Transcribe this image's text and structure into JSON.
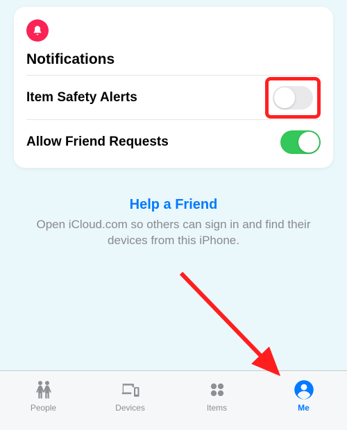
{
  "colors": {
    "accent": "#007aff",
    "notification_badge": "#fb2255",
    "toggle_on": "#34c759",
    "toggle_off": "#e9e9eb",
    "highlight": "#ff2020"
  },
  "card": {
    "title": "Notifications",
    "rows": [
      {
        "id": "item-safety-alerts",
        "label": "Item Safety Alerts",
        "on": false,
        "highlighted": true
      },
      {
        "id": "allow-friend-requests",
        "label": "Allow Friend Requests",
        "on": true,
        "highlighted": false
      }
    ]
  },
  "help": {
    "link": "Help a Friend",
    "text": "Open iCloud.com so others can sign in and find their devices from this iPhone."
  },
  "tabs": [
    {
      "id": "people",
      "label": "People",
      "icon": "people-icon",
      "active": false
    },
    {
      "id": "devices",
      "label": "Devices",
      "icon": "devices-icon",
      "active": false
    },
    {
      "id": "items",
      "label": "Items",
      "icon": "items-icon",
      "active": false
    },
    {
      "id": "me",
      "label": "Me",
      "icon": "me-icon",
      "active": true
    }
  ],
  "annotation": {
    "arrow_points_to": "tab-me"
  }
}
